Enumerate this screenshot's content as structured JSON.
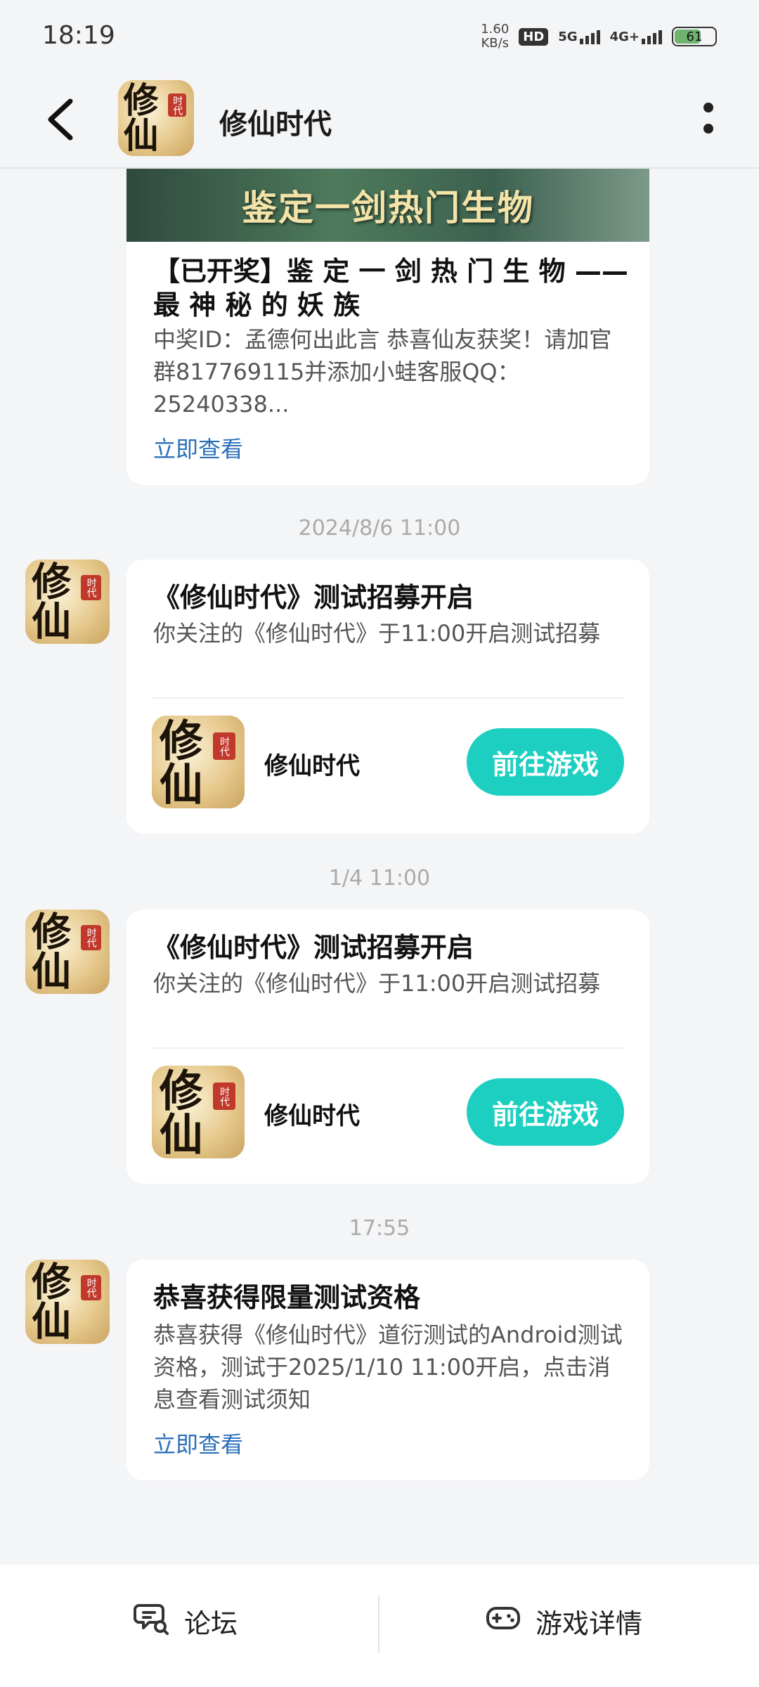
{
  "status": {
    "time": "18:19",
    "net_speed_value": "1.60",
    "net_speed_unit": "KB/s",
    "hd": "HD",
    "sim2": "5G",
    "sim1": "4G+",
    "battery": "61",
    "battery_level": 0.61
  },
  "header": {
    "title": "修仙时代",
    "logo_glyph": "修仙",
    "logo_seal": "时代"
  },
  "feed": {
    "banner_text": "鉴定一剑热门生物",
    "card1": {
      "title": "【已开奖】鉴 定 一 剑 热 门 生 物 —— 最 神 秘 的 妖 族",
      "body": "中奖ID：孟德何出此言 恭喜仙友获奖！请加官群817769115并添加小蛙客服QQ：25240338...",
      "link": "立即查看"
    },
    "timestamp1": "2024/8/6  11:00",
    "card2": {
      "title": "《修仙时代》测试招募开启",
      "body": "你关注的《修仙时代》于11:00开启测试招募",
      "game_name": "修仙时代",
      "button": "前往游戏"
    },
    "timestamp2": "1/4  11:00",
    "card3": {
      "title": "《修仙时代》测试招募开启",
      "body": "你关注的《修仙时代》于11:00开启测试招募",
      "game_name": "修仙时代",
      "button": "前往游戏"
    },
    "timestamp3": "17:55",
    "card4": {
      "title": "恭喜获得限量测试资格",
      "body": "恭喜获得《修仙时代》道衍测试的Android测试资格，测试于2025/1/10 11:00开启，点击消息查看测试须知",
      "link": "立即查看"
    }
  },
  "bottom": {
    "forum": "论坛",
    "game_details": "游戏详情"
  },
  "colors": {
    "accent": "#1ccfc0",
    "link": "#2a6fb8",
    "background": "#f4f5f7"
  }
}
